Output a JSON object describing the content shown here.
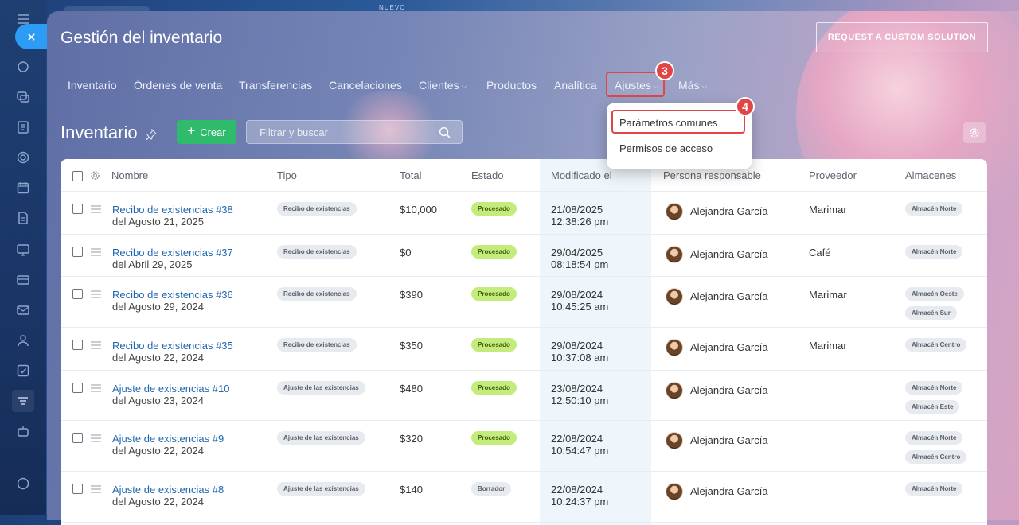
{
  "header_hint": "NUEVO",
  "app_title": "Gestión del inventario",
  "request_button": "REQUEST A CUSTOM SOLUTION",
  "nav": {
    "tabs": [
      {
        "label": "Inventario"
      },
      {
        "label": "Órdenes de venta"
      },
      {
        "label": "Transferencias"
      },
      {
        "label": "Cancelaciones"
      },
      {
        "label": "Clientes",
        "has_dropdown": true
      },
      {
        "label": "Productos"
      },
      {
        "label": "Analítica"
      },
      {
        "label": "Ajustes",
        "has_dropdown": true,
        "highlighted": true
      },
      {
        "label": "Más",
        "has_dropdown": true
      }
    ],
    "step_badge_ajustes": "3"
  },
  "dropdown": {
    "items": [
      "Parámetros comunes",
      "Permisos de acceso"
    ],
    "step_badge": "4"
  },
  "page": {
    "title": "Inventario",
    "create_button": "Crear",
    "search_placeholder": "Filtrar y buscar"
  },
  "table": {
    "columns": [
      "Nombre",
      "Tipo",
      "Total",
      "Estado",
      "Modificado el",
      "Persona responsable",
      "Proveedor",
      "Almacenes"
    ],
    "rows": [
      {
        "name": "Recibo de existencias #38",
        "sub": "del Agosto 21, 2025",
        "type": "Recibo de existencias",
        "total": "$10,000",
        "status": "Procesado",
        "date": "21/08/2025",
        "time": "12:38:26 pm",
        "person": "Alejandra García",
        "supplier": "Marimar",
        "warehouses": [
          "Almacén Norte"
        ]
      },
      {
        "name": "Recibo de existencias #37",
        "sub": "del Abril 29, 2025",
        "type": "Recibo de existencias",
        "total": "$0",
        "status": "Procesado",
        "date": "29/04/2025",
        "time": "08:18:54 pm",
        "person": "Alejandra García",
        "supplier": "Café",
        "warehouses": [
          "Almacén Norte"
        ]
      },
      {
        "name": "Recibo de existencias #36",
        "sub": "del Agosto 29, 2024",
        "type": "Recibo de existencias",
        "total": "$390",
        "status": "Procesado",
        "date": "29/08/2024",
        "time": "10:45:25 am",
        "person": "Alejandra García",
        "supplier": "Marimar",
        "warehouses": [
          "Almacén Oeste",
          "Almacén Sur"
        ]
      },
      {
        "name": "Recibo de existencias #35",
        "sub": "del Agosto 22, 2024",
        "type": "Recibo de existencias",
        "total": "$350",
        "status": "Procesado",
        "date": "29/08/2024",
        "time": "10:37:08 am",
        "person": "Alejandra García",
        "supplier": "Marimar",
        "warehouses": [
          "Almacén Centro"
        ]
      },
      {
        "name": "Ajuste de existencias #10",
        "sub": "del Agosto 23, 2024",
        "type": "Ajuste de las existencias",
        "total": "$480",
        "status": "Procesado",
        "date": "23/08/2024",
        "time": "12:50:10 pm",
        "person": "Alejandra García",
        "supplier": "",
        "warehouses": [
          "Almacén Norte",
          "Almacén Este"
        ]
      },
      {
        "name": "Ajuste de existencias #9",
        "sub": "del Agosto 22, 2024",
        "type": "Ajuste de las existencias",
        "total": "$320",
        "status": "Procesado",
        "date": "22/08/2024",
        "time": "10:54:47 pm",
        "person": "Alejandra García",
        "supplier": "",
        "warehouses": [
          "Almacén Norte",
          "Almacén Centro"
        ]
      },
      {
        "name": "Ajuste de existencias #8",
        "sub": "del Agosto 22, 2024",
        "type": "Ajuste de las existencias",
        "total": "$140",
        "status": "Borrador",
        "date": "22/08/2024",
        "time": "10:24:37 pm",
        "person": "Alejandra García",
        "supplier": "",
        "warehouses": [
          "Almacén Norte"
        ]
      }
    ]
  },
  "colors": {
    "accent_green": "#2fba6c",
    "link_blue": "#2067b0",
    "highlight_red": "#e04646",
    "status_ok": "#c4ec7d"
  }
}
